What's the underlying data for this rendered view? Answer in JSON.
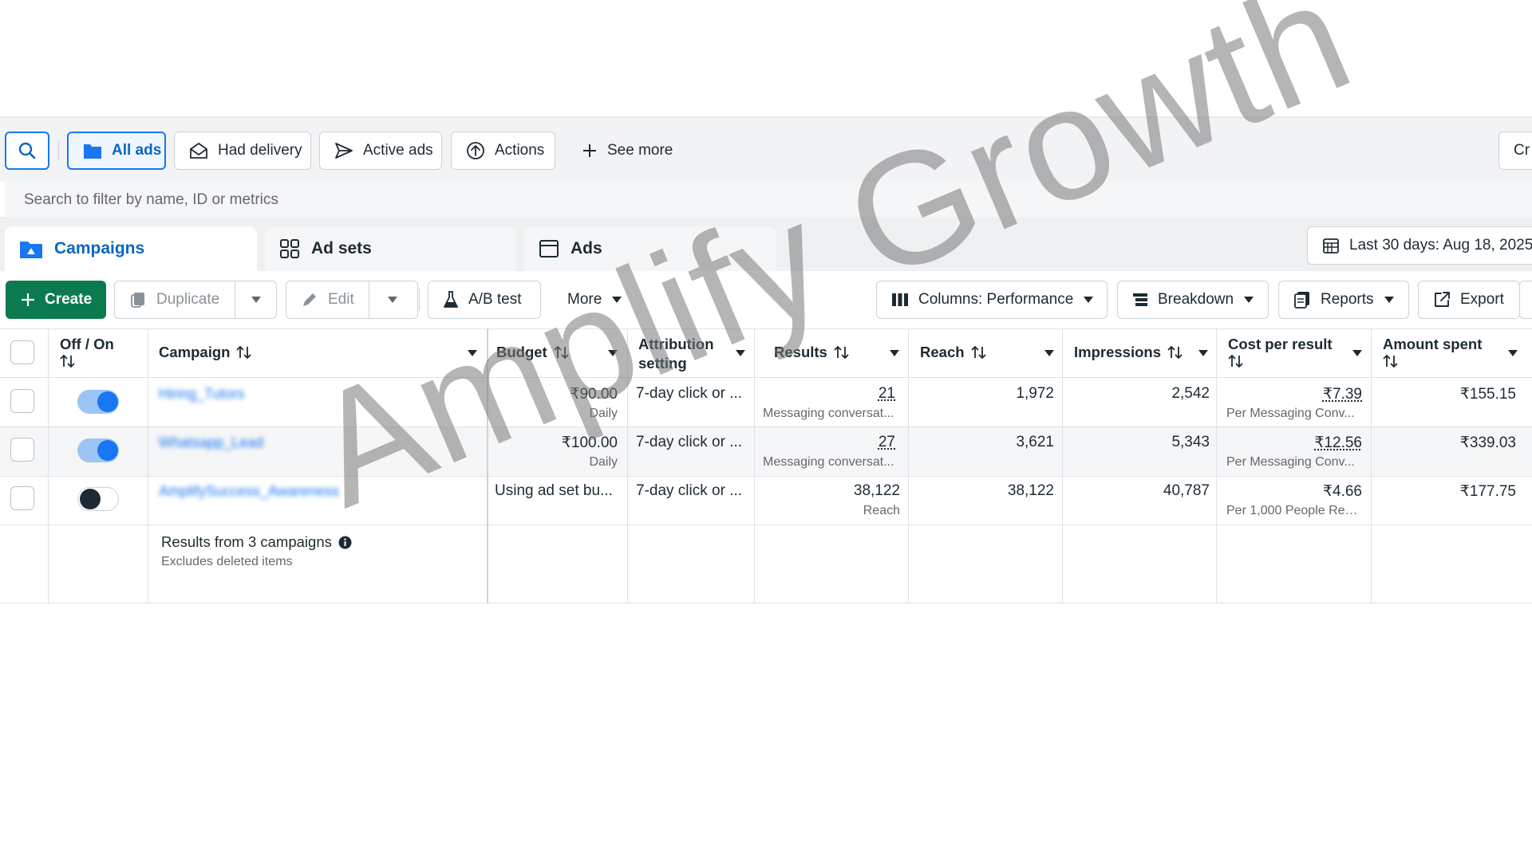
{
  "filters": {
    "all_ads": "All ads",
    "had_delivery": "Had delivery",
    "active_ads": "Active ads",
    "actions": "Actions",
    "see_more": "See more",
    "right_button": "Cr"
  },
  "search": {
    "placeholder": "Search to filter by name, ID or metrics"
  },
  "tabs": {
    "campaigns": "Campaigns",
    "ad_sets": "Ad sets",
    "ads": "Ads"
  },
  "date_range": "Last 30 days: Aug 18, 2025",
  "toolbar": {
    "create": "Create",
    "duplicate": "Duplicate",
    "edit": "Edit",
    "ab_test": "A/B test",
    "more": "More",
    "columns": "Columns: Performance",
    "breakdown": "Breakdown",
    "reports": "Reports",
    "export": "Export"
  },
  "table": {
    "headers": {
      "off_on": "Off / On",
      "campaign": "Campaign",
      "budget": "Budget",
      "attribution_line1": "Attribution",
      "attribution_line2": "setting",
      "results": "Results",
      "reach": "Reach",
      "impressions": "Impressions",
      "cost_per_result": "Cost per result",
      "amount_spent": "Amount spent"
    },
    "rows": [
      {
        "status": "on",
        "campaign": "Hiring_Tutors",
        "budget": "₹90.00",
        "budget_sub": "Daily",
        "attribution": "7-day click or ...",
        "results": "21",
        "results_sub": "Messaging conversat...",
        "reach": "1,972",
        "impressions": "2,542",
        "cost": "₹7.39",
        "cost_sub": "Per Messaging Conv...",
        "spent": "₹155.15"
      },
      {
        "status": "on",
        "campaign": "Whatsapp_Lead",
        "budget": "₹100.00",
        "budget_sub": "Daily",
        "attribution": "7-day click or ...",
        "results": "27",
        "results_sub": "Messaging conversat...",
        "reach": "3,621",
        "impressions": "5,343",
        "cost": "₹12.56",
        "cost_sub": "Per Messaging Conv...",
        "spent": "₹339.03"
      },
      {
        "status": "off",
        "campaign": "AmplifySuccess_Awareness",
        "budget": "Using ad set bu...",
        "budget_sub": "",
        "attribution": "7-day click or ...",
        "results": "38,122",
        "results_sub": "Reach",
        "reach": "38,122",
        "impressions": "40,787",
        "cost": "₹4.66",
        "cost_sub": "Per 1,000 People Rea...",
        "spent": "₹177.75"
      }
    ],
    "summary": {
      "title": "Results from 3 campaigns",
      "sub": "Excludes deleted items"
    }
  },
  "watermark": "Amplify Growth",
  "colors": {
    "accent": "#1877f2",
    "create_green": "#0b7a4f"
  }
}
